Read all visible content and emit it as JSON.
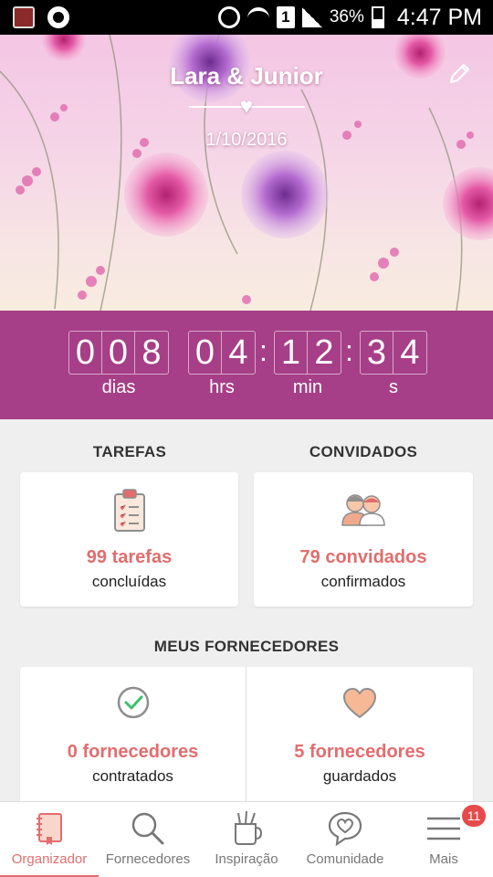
{
  "status_bar": {
    "sim_slot": "1",
    "battery": "36%",
    "time": "4:47 PM"
  },
  "hero": {
    "couple_names": "Lara & Junior",
    "wedding_date": "1/10/2016"
  },
  "countdown": {
    "days": [
      "0",
      "0",
      "8"
    ],
    "hours": [
      "0",
      "4"
    ],
    "minutes": [
      "1",
      "2"
    ],
    "seconds": [
      "3",
      "4"
    ],
    "labels": {
      "days": "dias",
      "hours": "hrs",
      "minutes": "min",
      "seconds": "s"
    }
  },
  "tasks": {
    "title": "TAREFAS",
    "count": "99 tarefas",
    "status": "concluídas"
  },
  "guests": {
    "title": "CONVIDADOS",
    "count": "79 convidados",
    "status": "confirmados"
  },
  "vendors": {
    "title": "MEUS FORNECEDORES",
    "hired_count": "0 fornecedores",
    "hired_status": "contratados",
    "saved_count": "5 fornecedores",
    "saved_status": "guardados"
  },
  "bottom_nav": {
    "items": [
      {
        "label": "Organizador",
        "icon": "notebook-icon",
        "active": true
      },
      {
        "label": "Fornecedores",
        "icon": "search-icon"
      },
      {
        "label": "Inspiração",
        "icon": "inspiration-cup-icon"
      },
      {
        "label": "Comunidade",
        "icon": "chat-heart-icon"
      },
      {
        "label": "Mais",
        "icon": "menu-icon",
        "badge": "11"
      }
    ]
  },
  "colors": {
    "accent": "#a63f87",
    "highlight": "#e26d6d",
    "background": "#efefef"
  }
}
